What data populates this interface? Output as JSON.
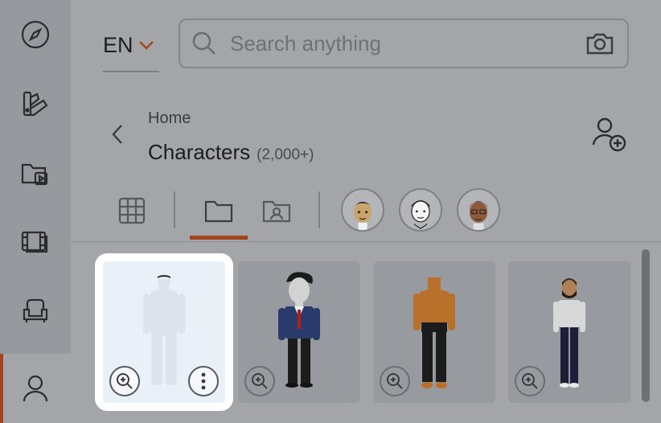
{
  "language": {
    "current": "EN"
  },
  "search": {
    "placeholder": "Search anything"
  },
  "breadcrumb": {
    "parent": "Home",
    "title": "Characters",
    "count": "(2,000+)"
  },
  "rail": {
    "items": [
      {
        "icon": "compass-icon",
        "active": false
      },
      {
        "icon": "palette-icon",
        "active": false
      },
      {
        "icon": "video-folder-icon",
        "active": false
      },
      {
        "icon": "film-icon",
        "active": false
      },
      {
        "icon": "armchair-icon",
        "active": false
      },
      {
        "icon": "person-icon",
        "active": true
      }
    ]
  },
  "tabs": [
    {
      "icon": "grid-icon",
      "active": false
    },
    {
      "icon": "folder-icon",
      "active": true
    },
    {
      "icon": "user-folder-icon",
      "active": false
    }
  ],
  "filter_avatars": [
    "avatar-1",
    "avatar-2",
    "avatar-3"
  ],
  "characters": [
    {
      "name": "ghost-figure",
      "selected": true
    },
    {
      "name": "businessman",
      "selected": false
    },
    {
      "name": "orange-figure",
      "selected": false
    },
    {
      "name": "bearded-man",
      "selected": false
    }
  ],
  "colors": {
    "accent": "#a2451f",
    "background": "#a3a5a8",
    "rail": "#969a9e",
    "card": "#979a9e",
    "selected_card": "#eaf0f8"
  }
}
